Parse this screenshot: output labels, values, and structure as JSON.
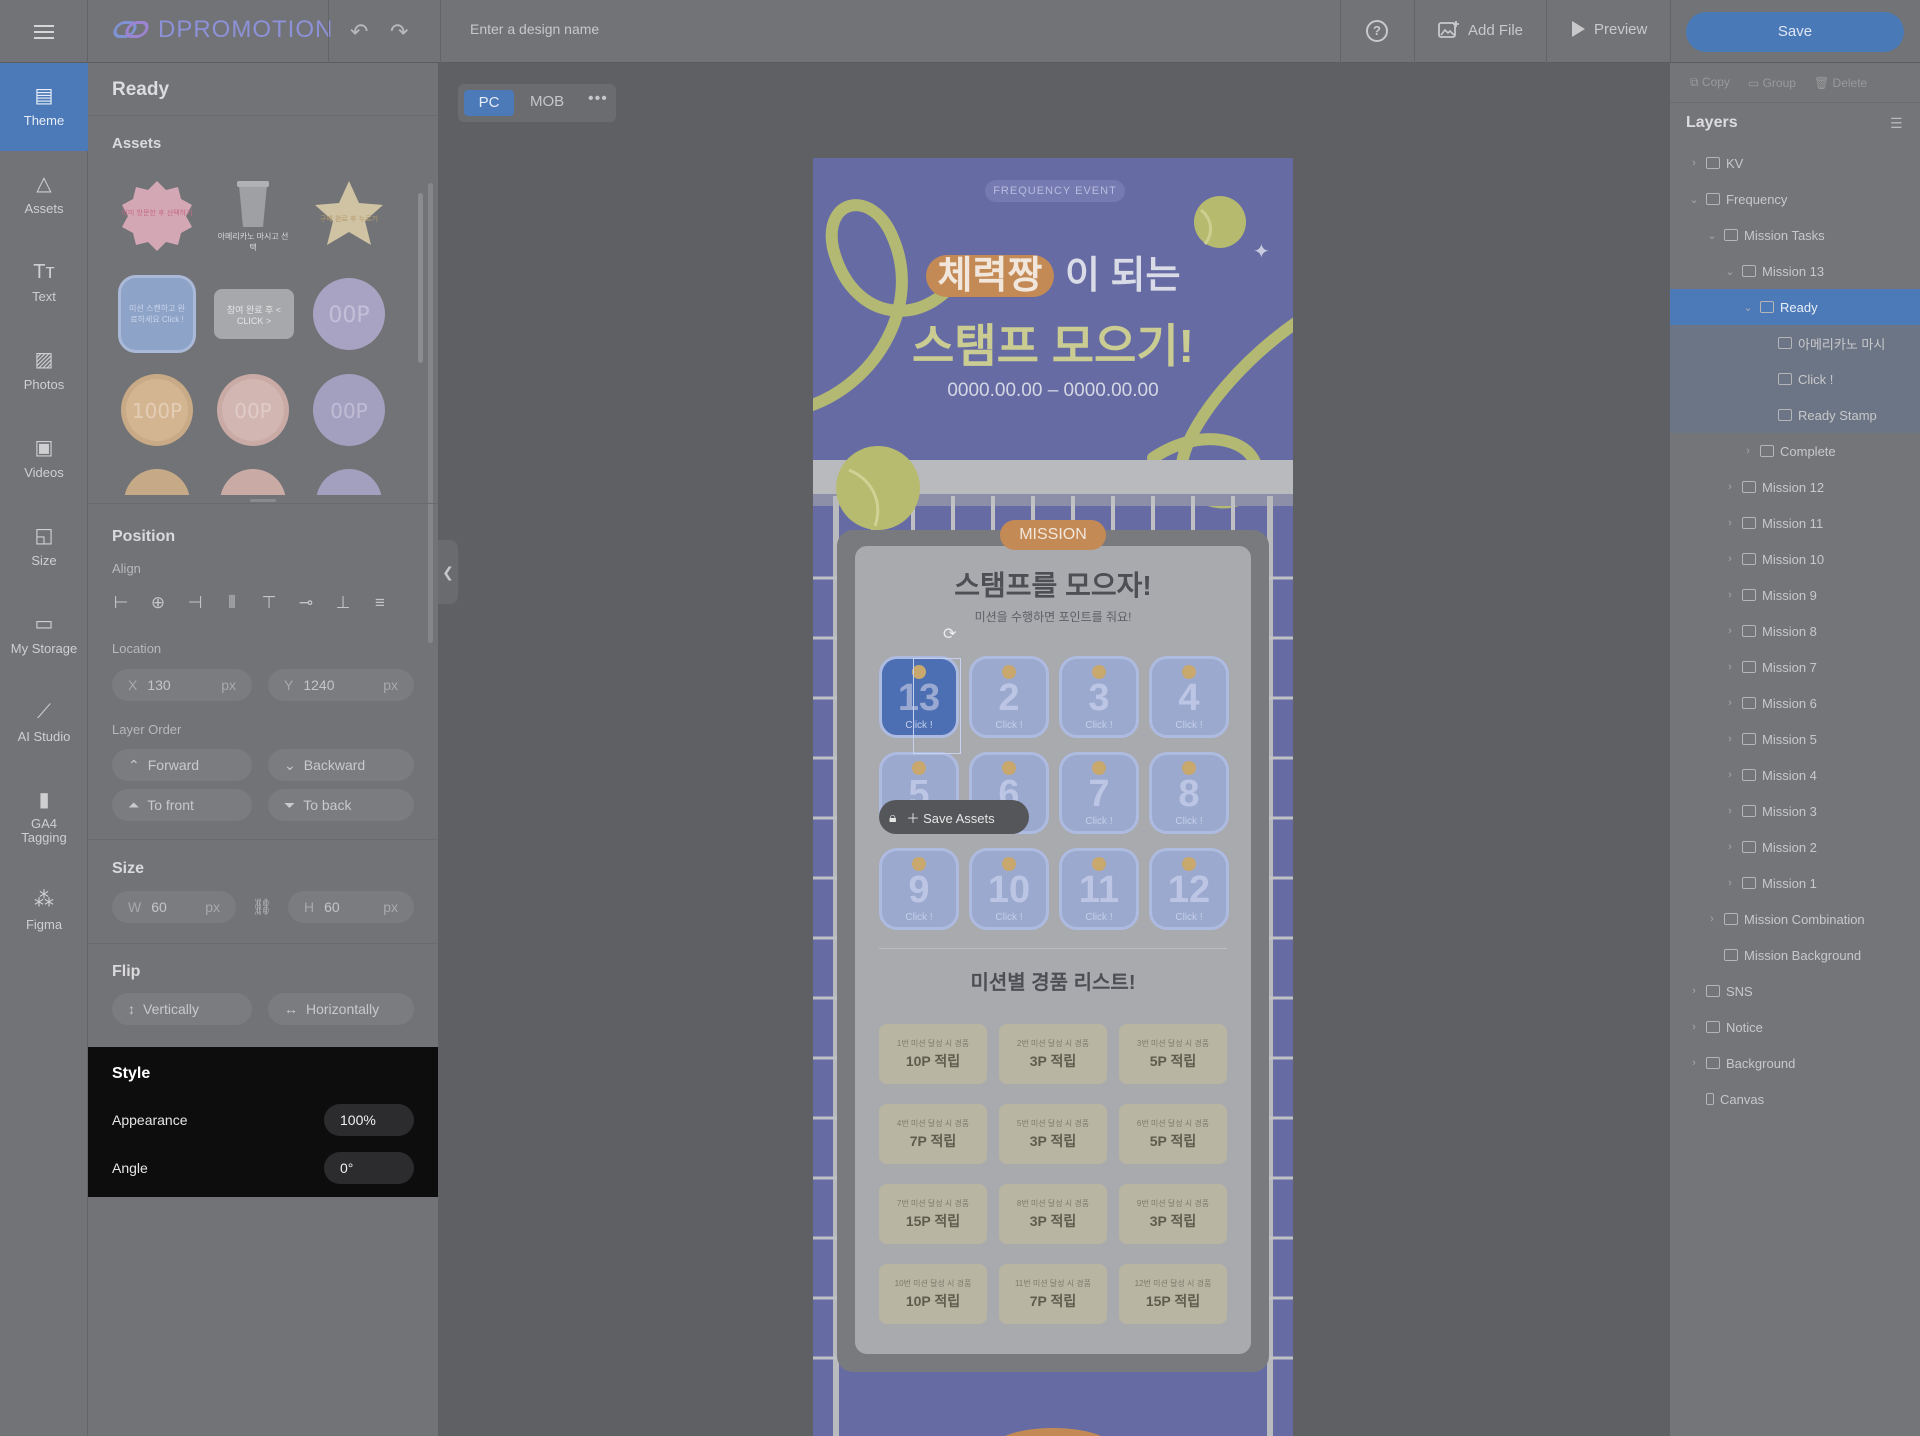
{
  "app": {
    "logo_text": "DPROMOTION"
  },
  "topbar": {
    "design_name_placeholder": "Enter a design name",
    "add_file": "Add File",
    "preview": "Preview",
    "save": "Save"
  },
  "leftnav": [
    {
      "label": "Theme",
      "icon": "theme-icon",
      "active": true
    },
    {
      "label": "Assets",
      "icon": "assets-icon"
    },
    {
      "label": "Text",
      "icon": "text-icon"
    },
    {
      "label": "Photos",
      "icon": "photos-icon"
    },
    {
      "label": "Videos",
      "icon": "videos-icon"
    },
    {
      "label": "Size",
      "icon": "size-icon"
    },
    {
      "label": "My Storage",
      "icon": "folder-icon"
    },
    {
      "label": "AI Studio",
      "icon": "ai-wand-icon"
    },
    {
      "label": "GA4 Tagging",
      "icon": "chart-icon"
    },
    {
      "label": "Figma",
      "icon": "figma-icon"
    }
  ],
  "panel": {
    "title": "Ready",
    "assets_label": "Assets",
    "assets": [
      {
        "text": "이미 방문한 후 선택하기"
      },
      {
        "text": "아메리카노 마시고 선택"
      },
      {
        "text": "구매 완료 후 누르기"
      },
      {
        "text": "미션 스캔하고 완료하세요 Click !"
      },
      {
        "text": "참여 완료 후 < CLICK >"
      },
      {
        "text": "00P"
      },
      {
        "text": "100P"
      },
      {
        "text": "00P"
      },
      {
        "text": "00P"
      }
    ],
    "position_label": "Position",
    "align_label": "Align",
    "location_label": "Location",
    "x_label": "X",
    "x_value": "130",
    "y_label": "Y",
    "y_value": "1240",
    "unit": "px",
    "layer_order_label": "Layer Order",
    "forward": "Forward",
    "backward": "Backward",
    "to_front": "To front",
    "to_back": "To back",
    "size_label": "Size",
    "w_label": "W",
    "w_value": "60",
    "h_label": "H",
    "h_value": "60",
    "flip_label": "Flip",
    "vertically": "Vertically",
    "horizontally": "Horizontally"
  },
  "style": {
    "title": "Style",
    "appearance_label": "Appearance",
    "appearance_value": "100%",
    "angle_label": "Angle",
    "angle_value": "0°"
  },
  "view": {
    "pc": "PC",
    "mob": "MOB"
  },
  "canvas": {
    "frequency_tag": "FREQUENCY  EVENT",
    "headline_highlight": "체력짱",
    "headline_rest": "이 되는",
    "headline_line2": "스탬프 모으기!",
    "date_range": "0000.00.00 – 0000.00.00",
    "mission_tag": "MISSION",
    "stamp_title": "스탬프를 모으자!",
    "stamp_subtitle": "미션을 수행하면 포인트를 줘요!",
    "save_assets": "Save Assets",
    "stamps": [
      "13",
      "2",
      "3",
      "4",
      "5",
      "6",
      "7",
      "8",
      "9",
      "10",
      "11",
      "12"
    ],
    "click_label": "Click !",
    "prize_title": "미션별 경품 리스트!",
    "prizes": [
      {
        "cap": "1번 미션 달성 시 경품",
        "pts": "10P 적립"
      },
      {
        "cap": "2번 미션 달성 시 경품",
        "pts": "3P 적립"
      },
      {
        "cap": "3번 미션 달성 시 경품",
        "pts": "5P 적립"
      },
      {
        "cap": "4번 미션 달성 시 경품",
        "pts": "7P 적립"
      },
      {
        "cap": "5번 미션 달성 시 경품",
        "pts": "3P 적립"
      },
      {
        "cap": "6번 미션 달성 시 경품",
        "pts": "5P 적립"
      },
      {
        "cap": "7번 미션 달성 시 경품",
        "pts": "15P 적립"
      },
      {
        "cap": "8번 미션 달성 시 경품",
        "pts": "3P 적립"
      },
      {
        "cap": "9번 미션 달성 시 경품",
        "pts": "3P 적립"
      },
      {
        "cap": "10번 미션 달성 시 경품",
        "pts": "10P 적립"
      },
      {
        "cap": "11번 미션 달성 시 경품",
        "pts": "7P 적립"
      },
      {
        "cap": "12번 미션 달성 시 경품",
        "pts": "15P 적립"
      }
    ]
  },
  "rightpanel": {
    "tools": [
      "Copy",
      "Group",
      "Delete"
    ],
    "layers_title": "Layers",
    "layers": [
      {
        "label": "KV",
        "indent": 0,
        "chev": "›",
        "icon": "folder-icon"
      },
      {
        "label": "Frequency",
        "indent": 0,
        "chev": "⌄",
        "icon": "globe-icon"
      },
      {
        "label": "Mission Tasks",
        "indent": 1,
        "chev": "⌄",
        "icon": "list-icon"
      },
      {
        "label": "Mission 13",
        "indent": 2,
        "chev": "⌄",
        "icon": "list-icon"
      },
      {
        "label": "Ready",
        "indent": 3,
        "chev": "⌄",
        "icon": "frame-icon",
        "selected": true
      },
      {
        "label": "아메리카노 마시",
        "indent": 4,
        "chev": "",
        "icon": "text-icon",
        "child": true
      },
      {
        "label": "Click !",
        "indent": 4,
        "chev": "",
        "icon": "text-icon",
        "child": true
      },
      {
        "label": "Ready Stamp",
        "indent": 4,
        "chev": "",
        "icon": "image-icon",
        "child": true
      },
      {
        "label": "Complete",
        "indent": 3,
        "chev": "›",
        "icon": "frame-icon"
      },
      {
        "label": "Mission 12",
        "indent": 2,
        "chev": "›",
        "icon": "list-icon"
      },
      {
        "label": "Mission 11",
        "indent": 2,
        "chev": "›",
        "icon": "list-icon"
      },
      {
        "label": "Mission 10",
        "indent": 2,
        "chev": "›",
        "icon": "list-icon"
      },
      {
        "label": "Mission 9",
        "indent": 2,
        "chev": "›",
        "icon": "list-icon"
      },
      {
        "label": "Mission 8",
        "indent": 2,
        "chev": "›",
        "icon": "list-icon"
      },
      {
        "label": "Mission 7",
        "indent": 2,
        "chev": "›",
        "icon": "list-icon"
      },
      {
        "label": "Mission 6",
        "indent": 2,
        "chev": "›",
        "icon": "list-icon"
      },
      {
        "label": "Mission 5",
        "indent": 2,
        "chev": "›",
        "icon": "list-icon"
      },
      {
        "label": "Mission 4",
        "indent": 2,
        "chev": "›",
        "icon": "list-icon"
      },
      {
        "label": "Mission 3",
        "indent": 2,
        "chev": "›",
        "icon": "list-icon"
      },
      {
        "label": "Mission 2",
        "indent": 2,
        "chev": "›",
        "icon": "list-icon"
      },
      {
        "label": "Mission 1",
        "indent": 2,
        "chev": "›",
        "icon": "list-icon"
      },
      {
        "label": "Mission Combination",
        "indent": 1,
        "chev": "›",
        "icon": "list-icon"
      },
      {
        "label": "Mission Background",
        "indent": 1,
        "chev": "",
        "icon": "frame-icon"
      },
      {
        "label": "SNS",
        "indent": 0,
        "chev": "›",
        "icon": "folder-icon"
      },
      {
        "label": "Notice",
        "indent": 0,
        "chev": "›",
        "icon": "folder-icon"
      },
      {
        "label": "Background",
        "indent": 0,
        "chev": "›",
        "icon": "folder-icon"
      },
      {
        "label": "Canvas",
        "indent": 0,
        "chev": "",
        "icon": "canvas-icon"
      }
    ]
  },
  "colors": {
    "accent": "#4c7ab8",
    "canvas_bg": "#666ca3",
    "style_panel": "#0d0d0e"
  }
}
